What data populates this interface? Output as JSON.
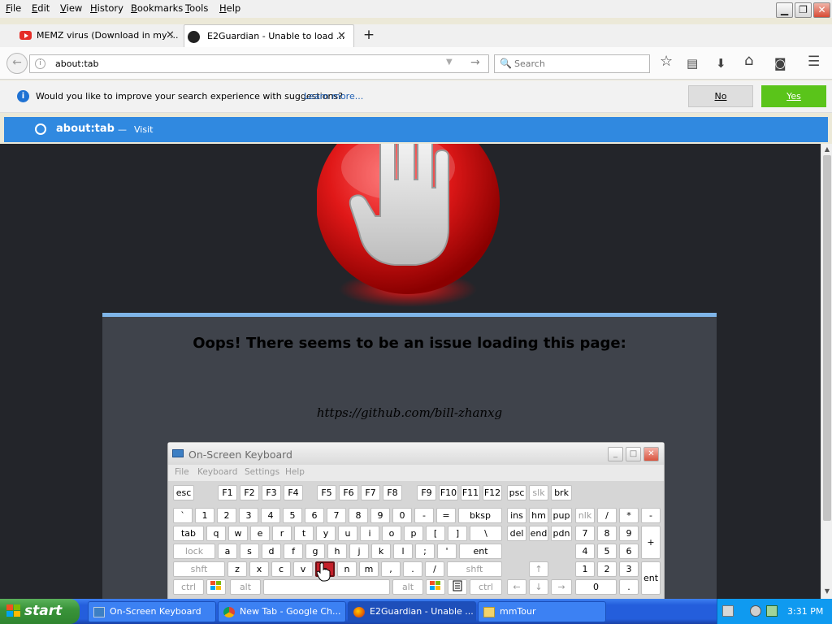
{
  "menubar": {
    "items": [
      {
        "accel": "F",
        "rest": "ile"
      },
      {
        "accel": "E",
        "rest": "dit"
      },
      {
        "accel": "V",
        "rest": "iew"
      },
      {
        "accel": "H",
        "rest": "istory"
      },
      {
        "accel": "B",
        "rest": "ookmarks"
      },
      {
        "accel": "T",
        "rest": "ools"
      },
      {
        "accel": "H",
        "rest": "elp"
      }
    ]
  },
  "window_controls": {
    "minimize": "▁",
    "restore": "❐",
    "close": "✕"
  },
  "tabs": [
    {
      "label": "MEMZ virus (Download in my ...",
      "icon": "youtube-icon"
    },
    {
      "label": "E2Guardian - Unable to load ...",
      "icon": "github-icon"
    }
  ],
  "tab_close": "✕",
  "new_tab": "+",
  "urlbar": {
    "value": "about:tab",
    "back": "←",
    "info": "i",
    "dropdown": "▼",
    "go": "→"
  },
  "search": {
    "placeholder": "Search",
    "icon": "🔍"
  },
  "toolbar_icons": {
    "bookmark": "☆",
    "reading_list": "▤",
    "downloads": "⬇",
    "home": "⌂",
    "pocket": "◙",
    "menu": "☰"
  },
  "notification": {
    "icon": "i",
    "text": "Would you like to improve your search experience with suggestions?",
    "link": "Learn more...",
    "no": "No",
    "yes": "Yes"
  },
  "suggestion": {
    "title": "about:tab",
    "separator": "—",
    "action": "Visit"
  },
  "page": {
    "error_title": "Oops! There seems to be an issue loading this page:",
    "blocked_url": "https://github.com/bill-zhanxg"
  },
  "scrollbar": {
    "up": "▲",
    "down": "▼"
  },
  "osk": {
    "title": "On-Screen Keyboard",
    "menu": [
      "File",
      "Keyboard",
      "Settings",
      "Help"
    ],
    "controls": {
      "minimize": "_",
      "maximize": "□",
      "close": "✕"
    },
    "keys": {
      "esc": "esc",
      "f1": "F1",
      "f2": "F2",
      "f3": "F3",
      "f4": "F4",
      "f5": "F5",
      "f6": "F6",
      "f7": "F7",
      "f8": "F8",
      "f9": "F9",
      "f10": "F10",
      "f11": "F11",
      "f12": "F12",
      "psc": "psc",
      "slk": "slk",
      "brk": "brk",
      "grave": "`",
      "n1": "1",
      "n2": "2",
      "n3": "3",
      "n4": "4",
      "n5": "5",
      "n6": "6",
      "n7": "7",
      "n8": "8",
      "n9": "9",
      "n0": "0",
      "minus": "-",
      "equals": "=",
      "bksp": "bksp",
      "ins": "ins",
      "hm": "hm",
      "pup": "pup",
      "nlk": "nlk",
      "np_div": "/",
      "np_mul": "*",
      "np_sub": "-",
      "tab": "tab",
      "q": "q",
      "w": "w",
      "e": "e",
      "r": "r",
      "t": "t",
      "y": "y",
      "u": "u",
      "i": "i",
      "o": "o",
      "p": "p",
      "lbr": "[",
      "rbr": "]",
      "bslash": "\\",
      "del": "del",
      "end": "end",
      "pdn": "pdn",
      "np7": "7",
      "np8": "8",
      "np9": "9",
      "np_add": "+",
      "lock": "lock",
      "a": "a",
      "s": "s",
      "d": "d",
      "f": "f",
      "g": "g",
      "h": "h",
      "j": "j",
      "k": "k",
      "l": "l",
      "semi": ";",
      "quote": "'",
      "ent": "ent",
      "np4": "4",
      "np5": "5",
      "np6": "6",
      "lshft": "shft",
      "z": "z",
      "x": "x",
      "c": "c",
      "v": "v",
      "b": "b",
      "n": "n",
      "m": "m",
      "comma": ",",
      "period": ".",
      "slash": "/",
      "rshft": "shft",
      "up": "↑",
      "np1": "1",
      "np2": "2",
      "np3": "3",
      "np_ent": "ent",
      "lctrl": "ctrl",
      "lalt": "alt",
      "ralt": "alt",
      "rctrl": "ctrl",
      "left": "←",
      "down": "↓",
      "right": "→",
      "np0": "0",
      "np_dot": "."
    }
  },
  "taskbar": {
    "start": "start",
    "items": [
      {
        "label": "On-Screen Keyboard"
      },
      {
        "label": "New Tab - Google Ch..."
      },
      {
        "label": "E2Guardian - Unable ..."
      },
      {
        "label": "mmTour"
      }
    ],
    "clock": "3:31 PM"
  },
  "colors": {
    "accent_blue": "#3089e0",
    "yes_green": "#5ac41a",
    "page_bg": "#23252a",
    "panel_bg": "#3f434b",
    "stop_red": "#e01818",
    "xp_blue": "#245edc",
    "start_green": "#3a943a"
  }
}
